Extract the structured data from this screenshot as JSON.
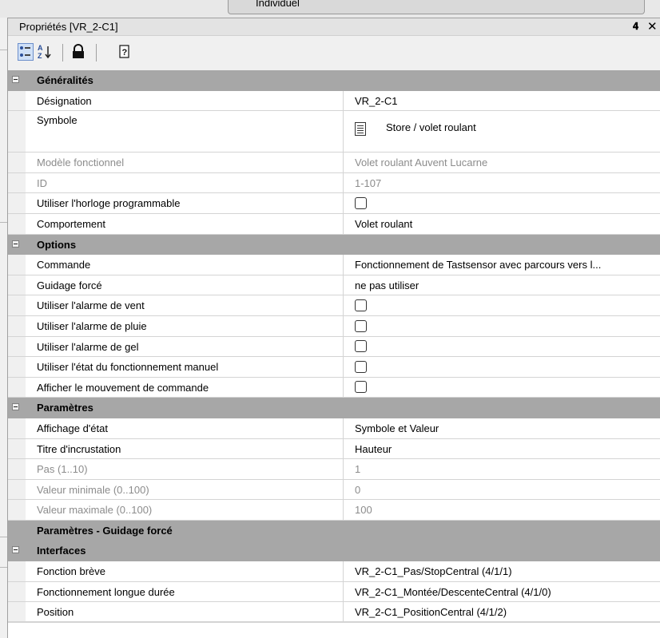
{
  "top_tab": {
    "label": "Individuel"
  },
  "panel": {
    "title": "Propriétés [VR_2-C1]",
    "pin_icon": "pin-icon",
    "close_icon": "close-icon"
  },
  "toolbar": {
    "icons": [
      "categorized-view-icon",
      "alphabetical-sort-icon",
      "lock-icon",
      "help-icon"
    ]
  },
  "rows": [
    {
      "type": "cat",
      "name": "Généralités"
    },
    {
      "type": "prop",
      "name": "Désignation",
      "value": "VR_2-C1"
    },
    {
      "type": "symbol",
      "name": "Symbole",
      "value": "Store / volet roulant",
      "icon": "shutter-icon"
    },
    {
      "type": "prop",
      "name": "Modèle fonctionnel",
      "value": "Volet roulant Auvent Lucarne",
      "disabled": true
    },
    {
      "type": "prop",
      "name": "ID",
      "value": "1-107",
      "disabled": true
    },
    {
      "type": "check",
      "name": "Utiliser l'horloge programmable",
      "checked": false
    },
    {
      "type": "prop",
      "name": "Comportement",
      "value": "Volet roulant"
    },
    {
      "type": "cat",
      "name": "Options"
    },
    {
      "type": "prop",
      "name": "Commande",
      "value": "Fonctionnement de Tastsensor avec parcours vers l..."
    },
    {
      "type": "prop",
      "name": "Guidage forcé",
      "value": "ne pas utiliser"
    },
    {
      "type": "check",
      "name": "Utiliser l'alarme de vent",
      "checked": false
    },
    {
      "type": "check",
      "name": "Utiliser l'alarme de pluie",
      "checked": false
    },
    {
      "type": "check",
      "name": "Utiliser l'alarme de gel",
      "checked": false
    },
    {
      "type": "check",
      "name": "Utiliser l'état du fonctionnement manuel",
      "checked": false
    },
    {
      "type": "check",
      "name": "Afficher le mouvement de commande",
      "checked": false
    },
    {
      "type": "cat",
      "name": "Paramètres"
    },
    {
      "type": "prop",
      "name": "Affichage d'état",
      "value": "Symbole et Valeur"
    },
    {
      "type": "prop",
      "name": "Titre d'incrustation",
      "value": "Hauteur"
    },
    {
      "type": "prop",
      "name": "Pas (1..10)",
      "value": "1",
      "disabled": true
    },
    {
      "type": "prop",
      "name": "Valeur minimale (0..100)",
      "value": "0",
      "disabled": true
    },
    {
      "type": "prop",
      "name": "Valeur maximale (0..100)",
      "value": "100",
      "disabled": true
    },
    {
      "type": "cat",
      "name": "Paramètres - Guidage forcé",
      "noToggle": true
    },
    {
      "type": "cat",
      "name": "Interfaces"
    },
    {
      "type": "prop",
      "name": "Fonction brève",
      "value": "VR_2-C1_Pas/StopCentral (4/1/1)"
    },
    {
      "type": "prop",
      "name": "Fonctionnement longue durée",
      "value": "VR_2-C1_Montée/DescenteCentral (4/1/0)"
    },
    {
      "type": "prop",
      "name": "Position",
      "value": "VR_2-C1_PositionCentral (4/1/2)"
    }
  ]
}
